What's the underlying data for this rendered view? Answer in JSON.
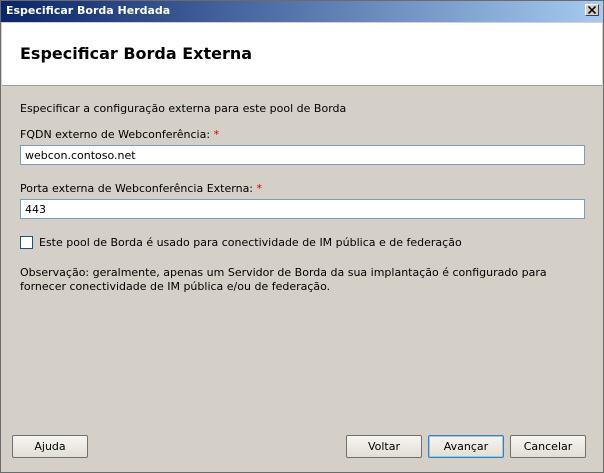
{
  "window": {
    "title": "Especificar Borda Herdada"
  },
  "header": {
    "heading": "Especificar Borda Externa"
  },
  "form": {
    "intro": "Especificar a configuração externa para este pool de Borda",
    "fqdn_label": "FQDN externo de Webconferência:",
    "fqdn_value": "webcon.contoso.net",
    "port_label": "Porta externa de Webconferência Externa:",
    "port_value": "443",
    "required_marker": "*",
    "federation_checkbox_label": "Este pool de Borda é usado para conectividade de IM pública e de federação",
    "federation_checked": false,
    "note": "Observação: geralmente, apenas um Servidor de Borda da sua implantação é configurado para fornecer conectividade de IM pública e/ou de federação."
  },
  "buttons": {
    "help": "Ajuda",
    "back": "Voltar",
    "next": "Avançar",
    "cancel": "Cancelar"
  },
  "icons": {
    "close": "close-icon"
  }
}
